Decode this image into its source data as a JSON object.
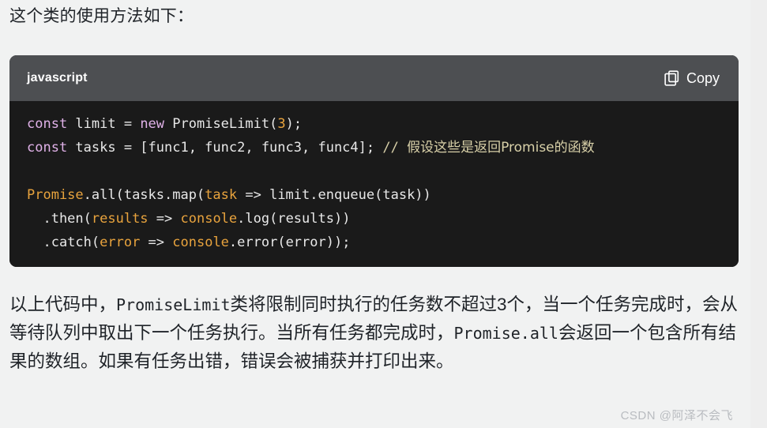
{
  "intro": {
    "text": "这个类的使用方法如下："
  },
  "code_block": {
    "language_label": "javascript",
    "copy_label": "Copy",
    "copy_icon": "copy-icon",
    "colors": {
      "header_bg": "#4d4f52",
      "body_bg": "#1a1a1a",
      "keyword": "#e0b1e8",
      "number": "#e8a33d",
      "function": "#e8a33d",
      "plain": "#e8e8e8",
      "comment": "#d8d0a8"
    },
    "lines": [
      {
        "id": "line-1",
        "tokens": [
          {
            "text": "const",
            "type": "kw"
          },
          {
            "text": " limit = ",
            "type": "plain"
          },
          {
            "text": "new",
            "type": "kw"
          },
          {
            "text": " PromiseLimit(",
            "type": "plain"
          },
          {
            "text": "3",
            "type": "num"
          },
          {
            "text": ");",
            "type": "plain"
          }
        ]
      },
      {
        "id": "line-2",
        "tokens": [
          {
            "text": "const",
            "type": "kw"
          },
          {
            "text": " tasks = [func1, func2, func3, func4]; ",
            "type": "plain"
          },
          {
            "text": "// ",
            "type": "com"
          },
          {
            "text": "假设这些是返回Promise的函数",
            "type": "comcjk"
          }
        ]
      },
      {
        "id": "line-3",
        "tokens": [
          {
            "text": "",
            "type": "plain"
          }
        ]
      },
      {
        "id": "line-4",
        "tokens": [
          {
            "text": "Promise",
            "type": "fn"
          },
          {
            "text": ".all(tasks.map(",
            "type": "plain"
          },
          {
            "text": "task",
            "type": "fn"
          },
          {
            "text": " => limit.enqueue(task))",
            "type": "plain"
          }
        ]
      },
      {
        "id": "line-5",
        "tokens": [
          {
            "text": "  .then(",
            "type": "plain"
          },
          {
            "text": "results",
            "type": "fn"
          },
          {
            "text": " => ",
            "type": "plain"
          },
          {
            "text": "console",
            "type": "fn"
          },
          {
            "text": ".log(results))",
            "type": "plain"
          }
        ]
      },
      {
        "id": "line-6",
        "tokens": [
          {
            "text": "  .catch(",
            "type": "plain"
          },
          {
            "text": "error",
            "type": "fn"
          },
          {
            "text": " => ",
            "type": "plain"
          },
          {
            "text": "console",
            "type": "fn"
          },
          {
            "text": ".error(error));",
            "type": "plain"
          }
        ]
      }
    ]
  },
  "body_paragraph": {
    "segments": [
      {
        "text": "以上代码中，",
        "mono": false
      },
      {
        "text": "PromiseLimit",
        "mono": true
      },
      {
        "text": "类将限制同时执行的任务数不超过3个，当一个任务完成时，会从等待队列中取出下一个任务执行。当所有任务都完成时，",
        "mono": false
      },
      {
        "text": "Promise.all",
        "mono": true
      },
      {
        "text": "会返回一个包含所有结果的数组。如果有任务出错，错误会被捕获并打印出来。",
        "mono": false
      }
    ]
  },
  "watermark": {
    "text": "CSDN @阿泽不会飞"
  }
}
